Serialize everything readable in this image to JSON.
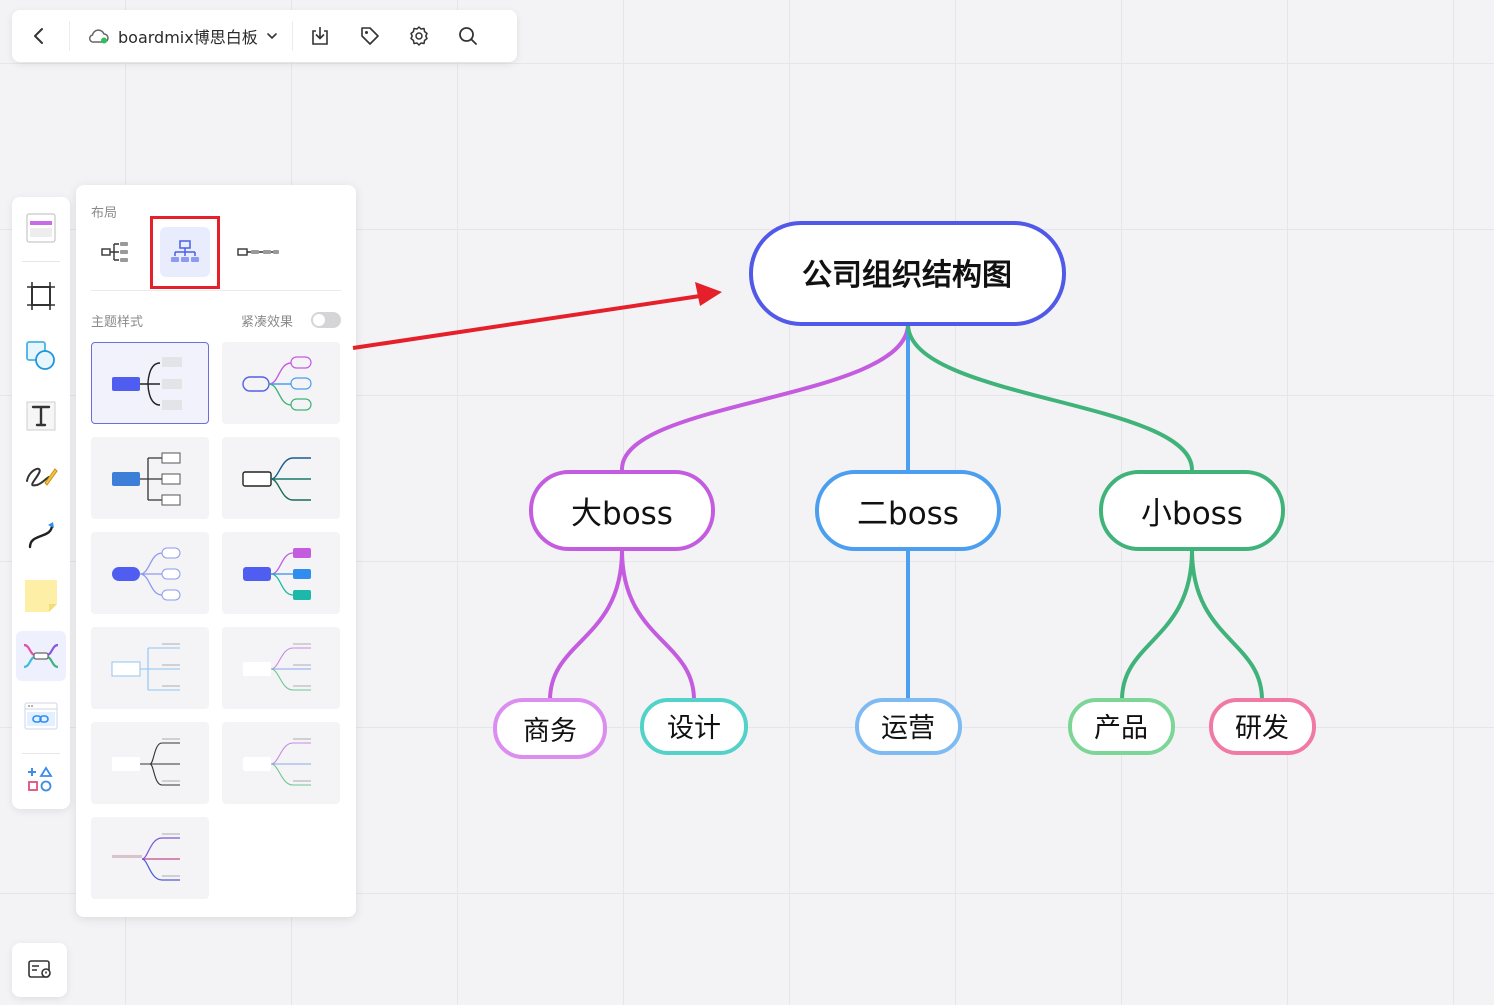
{
  "toolbar": {
    "back_icon": "chevron-left-icon",
    "cloud_icon": "cloud-sync-icon",
    "doc_title": "boardmix博思白板",
    "dropdown_icon": "chevron-down-icon",
    "actions": [
      "download-icon",
      "tag-icon",
      "settings-icon",
      "search-icon"
    ]
  },
  "left_toolbar": {
    "items": [
      "frame-template-icon",
      "crop-frame-icon",
      "shape-icon",
      "text-icon",
      "pen-icon",
      "connector-icon",
      "sticky-note-icon",
      "mindmap-icon",
      "embed-link-icon",
      "more-shapes-icon"
    ],
    "active": "mindmap-icon"
  },
  "bottom_left": {
    "icon": "minimap-icon"
  },
  "panel": {
    "layout_label": "布局",
    "layouts": [
      "logical-right",
      "org-chart",
      "timeline"
    ],
    "selected_layout": "org-chart",
    "theme_label": "主题样式",
    "compact_label": "紧凑效果",
    "compact_enabled": false,
    "theme_count": 11,
    "selected_theme": 0
  },
  "mindmap": {
    "root": "公司组织结构图",
    "level1": [
      "大boss",
      "二boss",
      "小boss"
    ],
    "level2": [
      "商务",
      "设计",
      "运营",
      "产品",
      "研发"
    ]
  },
  "colors": {
    "root_border": "#5159e8",
    "purple": "#c45ce0",
    "blue": "#4b9ef0",
    "green": "#3fb37a",
    "pink_light": "#dc8ef0",
    "teal": "#52d2c8",
    "light_blue": "#7dbbf2",
    "light_green": "#7dd698",
    "pink": "#f07aa3",
    "annotation_red": "#e5202a"
  }
}
